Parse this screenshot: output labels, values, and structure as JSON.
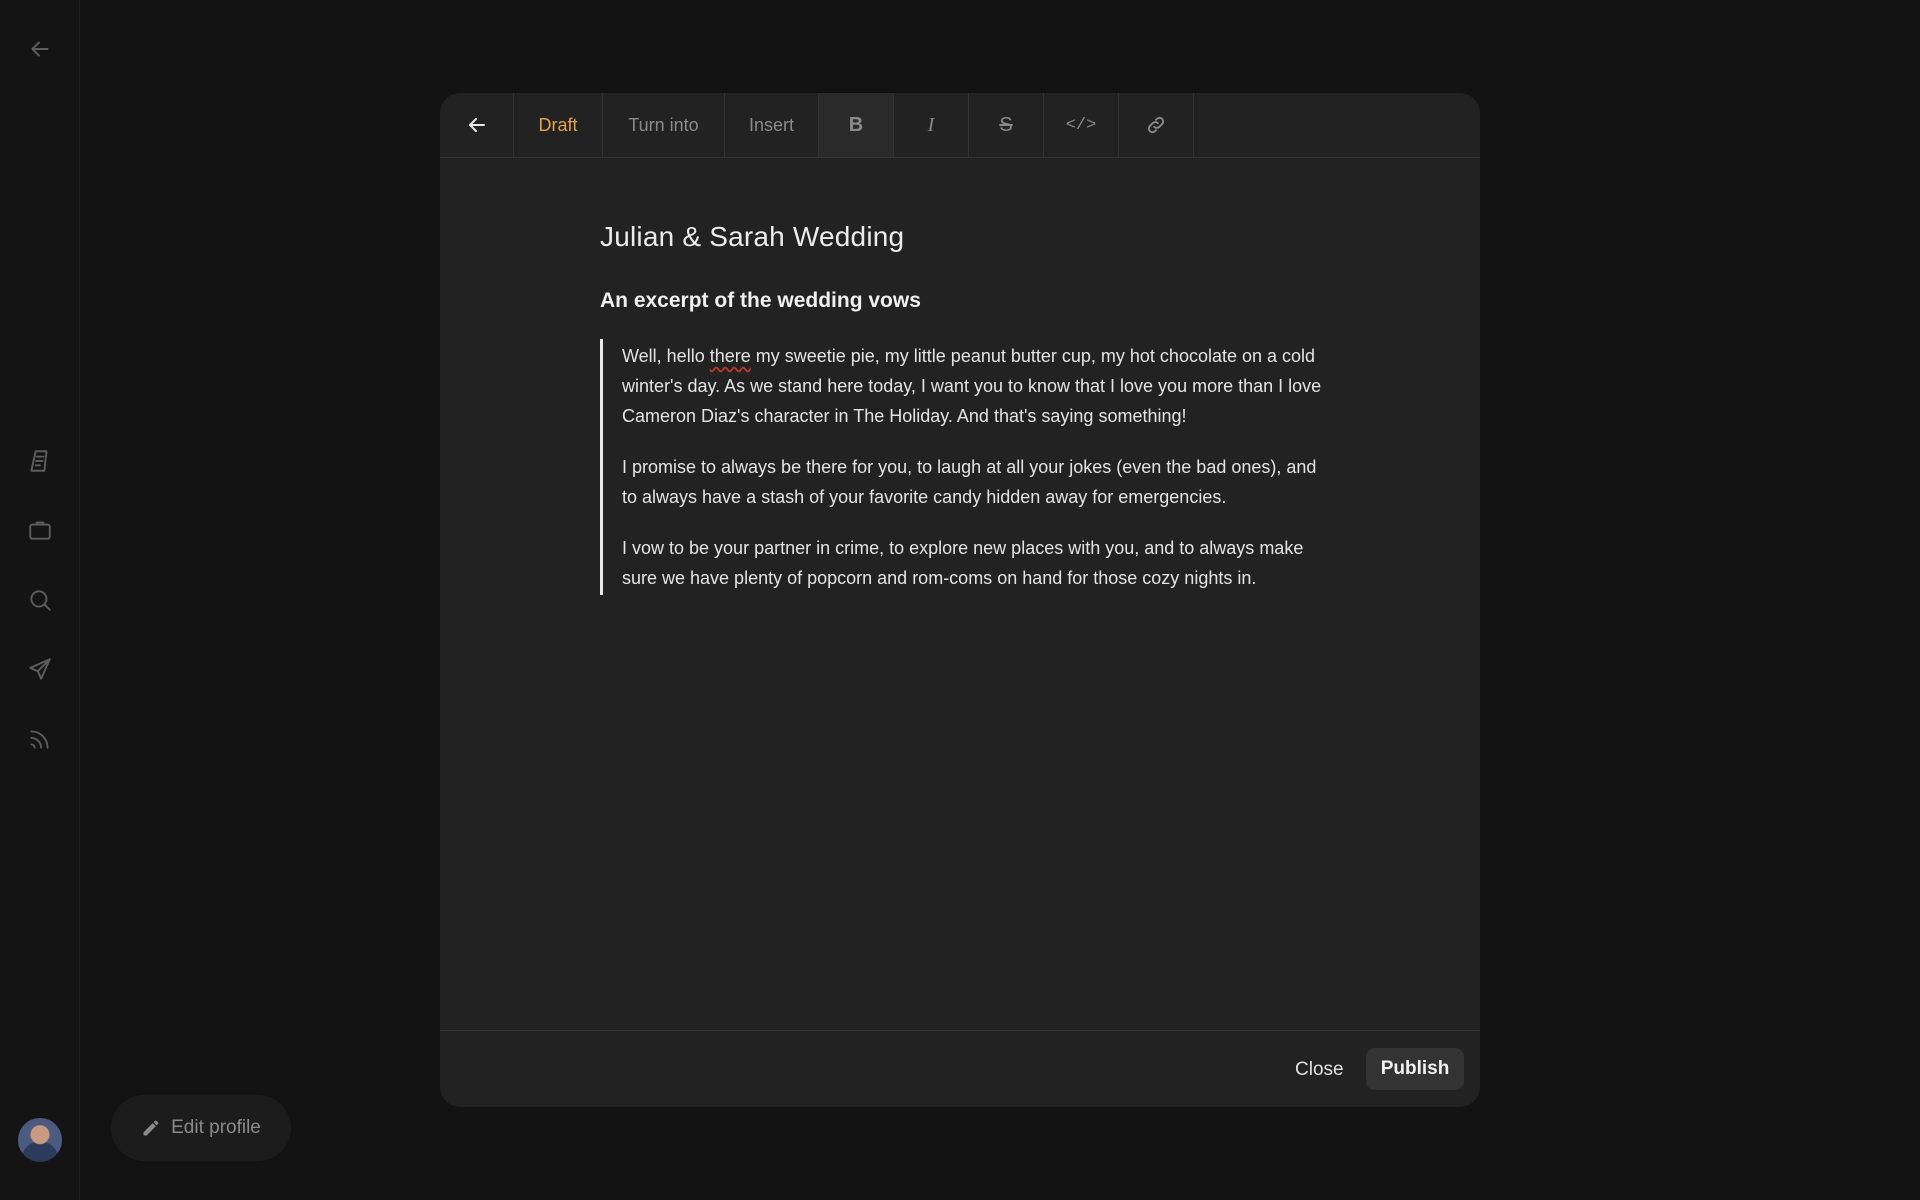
{
  "sidebar": {
    "icons": [
      "back-arrow-icon",
      "document-icon",
      "briefcase-icon",
      "search-icon",
      "send-icon",
      "rss-icon"
    ]
  },
  "profile": {
    "edit_label": "Edit profile"
  },
  "toolbar": {
    "draft_label": "Draft",
    "turn_into_label": "Turn into",
    "insert_label": "Insert",
    "bold_label": "B",
    "italic_label": "I",
    "strike_label": "S",
    "code_label": "</>",
    "accent_color": "#e3a24e"
  },
  "document": {
    "title": "Julian & Sarah Wedding",
    "subtitle": "An excerpt of the wedding vows",
    "quote": {
      "p1_before": "Well, hello ",
      "p1_misspelled": "there",
      "p1_after": " my sweetie pie, my little peanut butter cup, my hot chocolate on a cold winter's day. As we stand here today, I want you to know that I love you more than I love Cameron Diaz's character in The Holiday. And that's saying something!",
      "p2": "I promise to always be there for you, to laugh at all your jokes (even the bad ones), and to always have a stash of your favorite candy hidden away for emergencies.",
      "p3": "I vow to be your partner in crime, to explore new places with you, and to always make sure we have plenty of popcorn and rom-coms on hand for those cozy nights in."
    }
  },
  "footer": {
    "close_label": "Close",
    "publish_label": "Publish"
  }
}
